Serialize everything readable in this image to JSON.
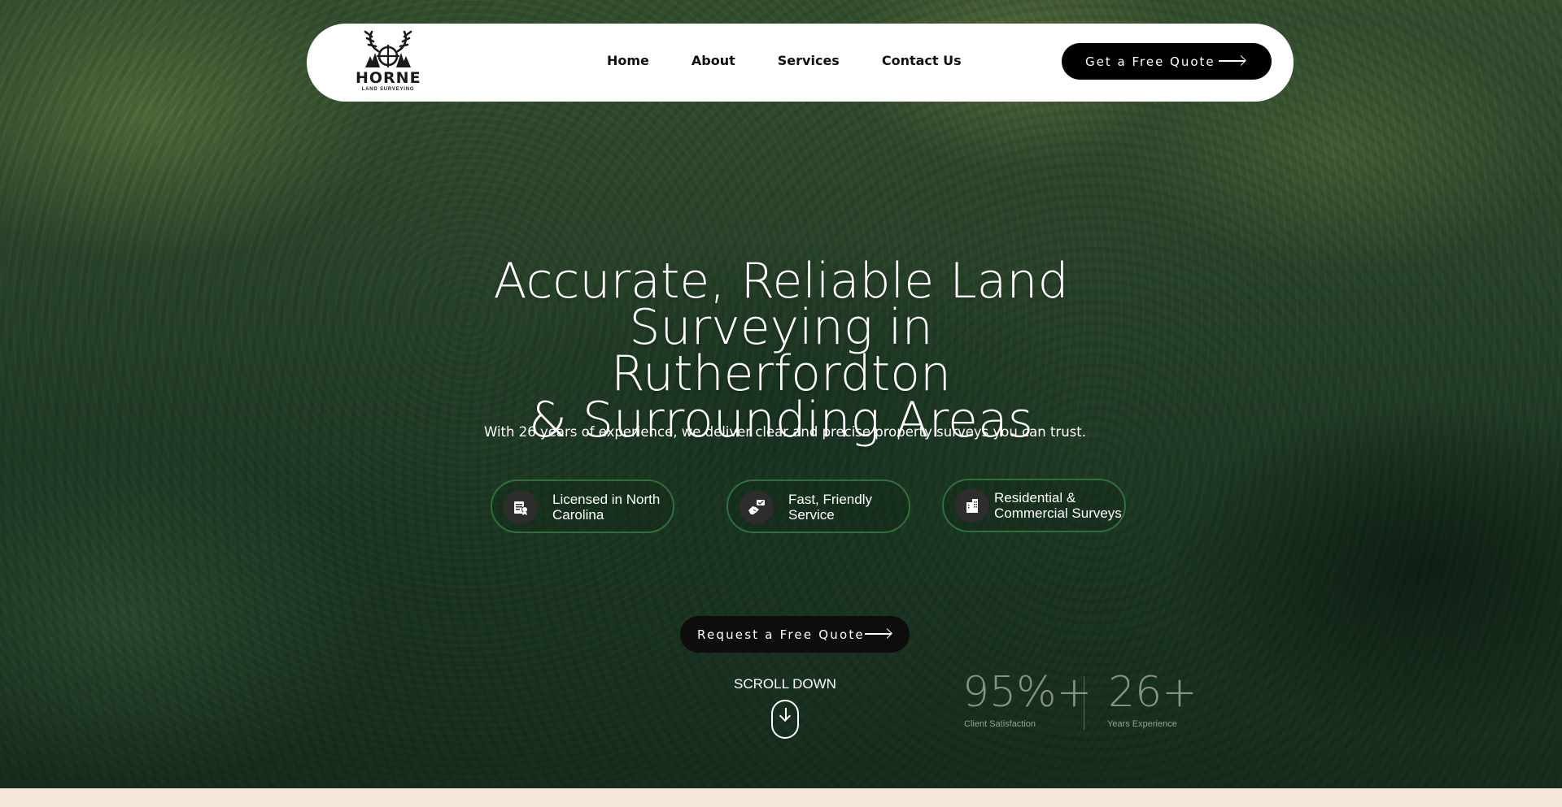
{
  "nav": {
    "logo_name": "HORNE",
    "logo_sub": "LAND SURVEYING",
    "links": [
      "Home",
      "About",
      "Services",
      "Contact Us"
    ],
    "cta_label": "Get a Free Quote"
  },
  "hero": {
    "headline_lines": [
      "Accurate, Reliable Land",
      "Surveying in Rutherfordton",
      "& Surrounding Areas"
    ],
    "subline": "With 26 years of experience, we deliver clear and precise property surveys you can trust.",
    "features": [
      {
        "label_line1": "Licensed in North",
        "label_line2": "Carolina",
        "icon": "license-icon"
      },
      {
        "label_line1": "Fast, Friendly",
        "label_line2": "Service",
        "icon": "handshake-icon"
      },
      {
        "label_line1": "Residential &",
        "label_line2": "Commercial Surveys",
        "icon": "building-icon"
      }
    ],
    "request_label": "Request a Free Quote",
    "scroll_label": "SCROLL DOWN"
  },
  "stats": [
    {
      "value": "95%+",
      "label": "Client Satisfaction"
    },
    {
      "value": "26+",
      "label": "Years Experience"
    }
  ],
  "colors": {
    "accent_green": "#2f6e3d",
    "button_black": "#000000",
    "page_cream": "#f3e7da"
  }
}
